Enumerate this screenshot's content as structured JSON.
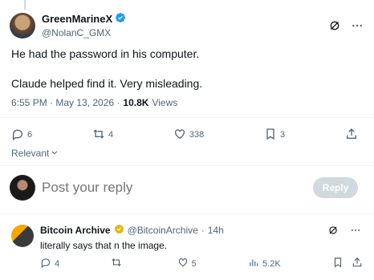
{
  "tweet": {
    "display_name": "GreenMarineX",
    "handle": "@NolanC_GMX",
    "text_lines": [
      "He had the password in his computer.",
      "Claude helped find it. Very misleading."
    ],
    "timestamp": "6:55 PM · May 13, 2026 ·",
    "views_count": "10.8K",
    "views_label": "Views",
    "stats": {
      "replies": "6",
      "reposts": "4",
      "likes": "338",
      "bookmarks": "3"
    }
  },
  "sort": {
    "label": "Relevant"
  },
  "composer": {
    "placeholder": "Post your reply",
    "button_label": "Reply"
  },
  "reply": {
    "display_name": "Bitcoin Archive",
    "handle": "@BitcoinArchive",
    "dot": "·",
    "time": "14h",
    "text": "literally says that n the image.",
    "stats": {
      "replies": "4",
      "reposts": "",
      "likes": "5",
      "views": "5.2K"
    }
  },
  "colors": {
    "verified_blue": "#1d9bf0",
    "verified_gold": "#e2b719",
    "muted": "#536471",
    "reply_button_disabled": "#cfd9de"
  },
  "icons": [
    "verified-badge-icon",
    "grok-icon",
    "more-icon",
    "reply-icon",
    "repost-icon",
    "like-icon",
    "bookmark-icon",
    "share-icon",
    "chevron-down-icon",
    "views-icon"
  ]
}
